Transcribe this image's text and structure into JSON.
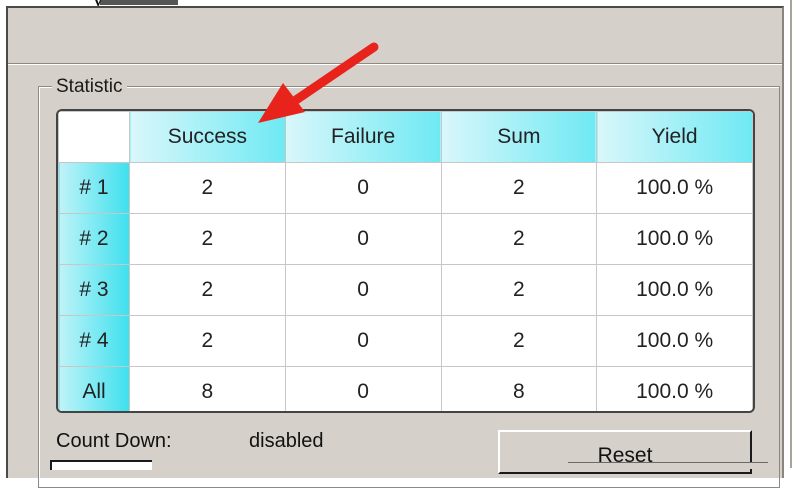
{
  "top_fragment": "y",
  "group": {
    "title": "Statistic"
  },
  "table": {
    "headers": [
      "Success",
      "Failure",
      "Sum",
      "Yield"
    ],
    "rows": [
      {
        "label": "# 1",
        "success": "2",
        "failure": "0",
        "sum": "2",
        "yield": "100.0 %"
      },
      {
        "label": "# 2",
        "success": "2",
        "failure": "0",
        "sum": "2",
        "yield": "100.0 %"
      },
      {
        "label": "# 3",
        "success": "2",
        "failure": "0",
        "sum": "2",
        "yield": "100.0 %"
      },
      {
        "label": "# 4",
        "success": "2",
        "failure": "0",
        "sum": "2",
        "yield": "100.0 %"
      },
      {
        "label": "All",
        "success": "8",
        "failure": "0",
        "sum": "8",
        "yield": "100.0 %"
      }
    ]
  },
  "countdown": {
    "label": "Count Down:",
    "value": "disabled"
  },
  "reset_label": "Reset",
  "colors": {
    "panel_bg": "#d5d0c9",
    "header_cyan": "#6fe9f3",
    "annotation_arrow": "#e8231c"
  },
  "icons": {
    "annotation": "red-arrow-icon"
  }
}
